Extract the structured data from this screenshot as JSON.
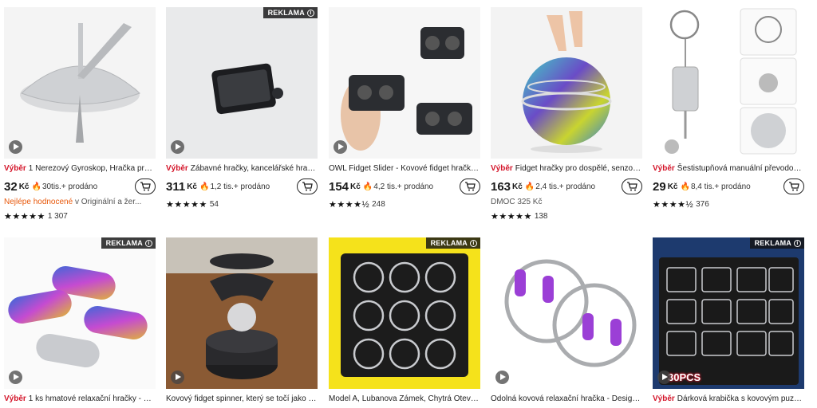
{
  "ad_label": "REKLAMA",
  "currency": "Kč",
  "sold_suffix": "prodáno",
  "row1": [
    {
      "badge": "Výběr",
      "title": "1 Nerezový Gyroskop, Hračka pro U...",
      "price": "32",
      "sold": "30tis.+",
      "line3_highlight": "Nejlépe hodnocené",
      "line3_text": " v Originální a žer...",
      "stars": "★★★★★",
      "reviews": "1 307",
      "ad": false,
      "play": true
    },
    {
      "badge": "Výběr",
      "title": "Zábavné hračky, kancelářské hračky...",
      "price": "311",
      "sold": "1,2 tis.+",
      "stars": "★★★★★",
      "reviews": "54",
      "ad": true,
      "play": true
    },
    {
      "badge": "",
      "title": "OWL Fidget Slider - Kovové fidget hračky p...",
      "price": "154",
      "sold": "4,2 tis.+",
      "stars": "★★★★½",
      "reviews": "248",
      "ad": false,
      "play": true
    },
    {
      "badge": "Výběr",
      "title": "Fidget hračky pro dospělé, senzoric...",
      "price": "163",
      "sold": "2,4 tis.+",
      "line3_text": "DMOC 325 Kč",
      "stars": "★★★★★",
      "reviews": "138",
      "ad": false,
      "play": false
    },
    {
      "badge": "Výběr",
      "title": "Šestistupňová manuální převodovk...",
      "price": "29",
      "sold": "8,4 tis.+",
      "stars": "★★★★½",
      "reviews": "376",
      "ad": false,
      "play": false
    }
  ],
  "row2": [
    {
      "badge": "Výběr",
      "title": "1 ks hmatové relaxační hračky - Pře...",
      "ad": true
    },
    {
      "badge": "",
      "title": "Kovový fidget spinner, který se točí jako gy...",
      "ad": false
    },
    {
      "badge": "",
      "title": "Model A, Lubanova Zámek, Chytrá Otevíra...",
      "ad": true
    },
    {
      "badge": "",
      "title": "Odolná kovová relaxační hračka - Design ř...",
      "ad": false
    },
    {
      "badge": "Výběr",
      "title": "Dárková krabička s kovovým puzzle ...",
      "ad": true,
      "overlay": "30PCS"
    }
  ]
}
